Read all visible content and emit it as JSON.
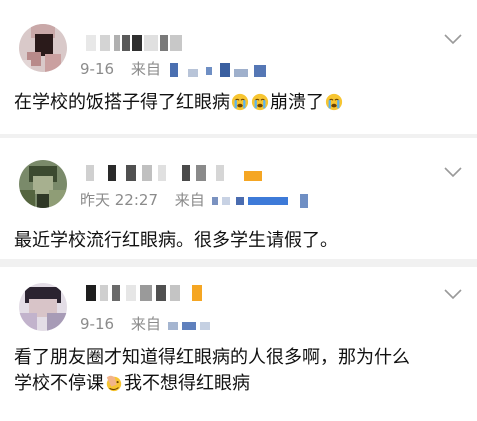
{
  "colors": {
    "meta_text": "#8b8b8b",
    "divider": "#f1f1f1",
    "orange_mark": "#f5a623",
    "blue_mark": "#3d7ad8"
  },
  "comments": [
    {
      "time": "9-16",
      "from_label": "来自",
      "text_before": "在学校的饭搭子得了红眼病",
      "text_after": "崩溃了",
      "emoji": "crying-face-icon",
      "menu_icon": "chevron-down-icon"
    },
    {
      "time": "昨天 22:27",
      "from_label": "来自",
      "text": "最近学校流行红眼病。很多学生请假了。",
      "menu_icon": "chevron-down-icon"
    },
    {
      "time": "9-16",
      "from_label": "来自",
      "text_line1": "看了朋友圈才知道得红眼病的人很多啊，那为什么",
      "text_line2_before": "学校不停课",
      "text_line2_after": "我不想得红眼病",
      "emoji": "facepalm-icon",
      "menu_icon": "chevron-down-icon"
    }
  ]
}
